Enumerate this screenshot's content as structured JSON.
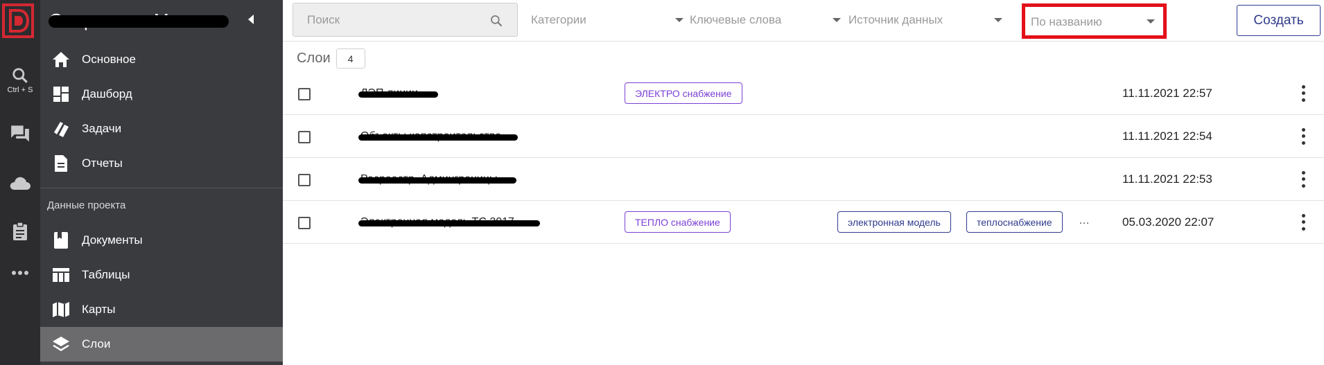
{
  "rail": {
    "logo": "D",
    "search_hint": "Ctrl + S",
    "items": [
      "search-icon",
      "chat-icon",
      "cloud-icon",
      "clipboard-icon",
      "more-horizontal-icon"
    ]
  },
  "sidebar": {
    "title": "Энергетика Москвы",
    "nav": [
      {
        "label": "Основное",
        "icon": "home-icon"
      },
      {
        "label": "Дашборд",
        "icon": "dashboard-icon"
      },
      {
        "label": "Задачи",
        "icon": "tasks-icon"
      },
      {
        "label": "Отчеты",
        "icon": "report-icon"
      }
    ],
    "section_label": "Данные проекта",
    "project_nav": [
      {
        "label": "Документы",
        "icon": "document-icon"
      },
      {
        "label": "Таблицы",
        "icon": "table-icon"
      },
      {
        "label": "Карты",
        "icon": "map-icon"
      },
      {
        "label": "Слои",
        "icon": "layers-icon",
        "active": true
      }
    ]
  },
  "toolbar": {
    "search_placeholder": "Поиск",
    "filters": [
      "Категории",
      "Ключевые слова",
      "Источник данных"
    ],
    "sort_value": "По названию",
    "create_label": "Создать"
  },
  "layers": {
    "title": "Слои",
    "count": "4",
    "rows": [
      {
        "name": "ЛЭП линии",
        "category": "ЭЛЕКТРО снабжение",
        "keywords": [],
        "date": "11.11.2021 22:57"
      },
      {
        "name": "Объекты капстроительства",
        "category": "",
        "keywords": [],
        "date": "11.11.2021 22:54"
      },
      {
        "name": "Росреестр. Админграницы",
        "category": "",
        "keywords": [],
        "date": "11.11.2021 22:53"
      },
      {
        "name": "Электронная модель ТС 2017",
        "category": "ТЕПЛО снабжение",
        "keywords": [
          "электронная модель",
          "теплоснабжение"
        ],
        "more_keywords": "…",
        "date": "05.03.2020 22:07"
      }
    ]
  },
  "colors": {
    "rail_bg": "#2c2c2f",
    "sidebar_bg": "#3a3b3f",
    "active_item_bg": "#6b6b6e",
    "brand_red": "#d42832",
    "highlight_red": "#e3101a",
    "primary_blue": "#2e3a8c",
    "category_purple": "#7b3fd6"
  }
}
